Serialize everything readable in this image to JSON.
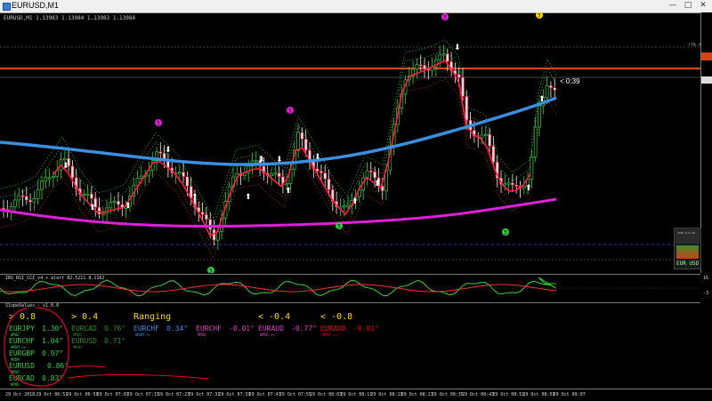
{
  "window": {
    "title": "EURUSD,M1",
    "controls": [
      "—",
      "□",
      "✕"
    ]
  },
  "chart_header": {
    "symbol_line": "EURUSD,M1 1.13983 1.13984 1.13983 1.13984"
  },
  "main_chart": {
    "countdown": "< 0:39",
    "level_label": "(76.4%)",
    "marker_digit": "3",
    "bar_countdown_prefix": "<",
    "widget_label": "EUR USD"
  },
  "indicator1": {
    "header": "IBS_RSI_CCI_v4 + alert 82.5211 8.1162",
    "scale_top": "16",
    "scale_bottom": "-3"
  },
  "indicator2": {
    "header": "SlopeValues - v1.0.6",
    "columns": [
      {
        "label": "> 0.8",
        "color": "#ffd700"
      },
      {
        "label": "> 0.4",
        "color": "#ffd700"
      },
      {
        "label": "Ranging",
        "color": "#ffd700"
      },
      {
        "label": "< -0.4",
        "color": "#ffd700"
      },
      {
        "label": "< -0.8",
        "color": "#ffd700"
      }
    ],
    "col1": [
      {
        "pair": "EURJPY",
        "value": "1.30°",
        "sub": "WMOD"
      },
      {
        "pair": "EURCHF",
        "value": "1.04°",
        "sub": "WMDM ++"
      },
      {
        "pair": "EURGBP",
        "value": "0.97°",
        "sub": "MDDM"
      },
      {
        "pair": "EURUSD",
        "value": "0.86°",
        "sub": "MMOD"
      },
      {
        "pair": "EURCAD",
        "value": "0.83°",
        "sub": "WDMD"
      }
    ],
    "col2": [
      {
        "pair": "EURCAD",
        "value": "0.76°",
        "sub": "MMOD"
      },
      {
        "pair": "EURUSD",
        "value": "0.71°",
        "sub": "MMOD"
      }
    ],
    "col3": [
      {
        "pair": "EURCHF",
        "value": "0.34°",
        "sub": "WDOM ++"
      }
    ],
    "col4": [
      {
        "pair": "EURCHF",
        "value": "-0.01°",
        "sub": "MMOD"
      },
      {
        "pair": "EURAUD",
        "value": "-0.77°",
        "sub": "WMOD ++"
      }
    ],
    "col5": [
      {
        "pair": "EURAUD",
        "value": "-0.91°",
        "sub": "WMOD ++"
      }
    ]
  },
  "time_axis": [
    "29 Oct 2018",
    "29 Oct 06:51",
    "29 Oct 06:59",
    "29 Oct 07:07",
    "29 Oct 07:15",
    "29 Oct 07:23",
    "29 Oct 07:31",
    "29 Oct 07:39",
    "29 Oct 07:47",
    "29 Oct 07:55",
    "29 Oct 08:03",
    "29 Oct 08:11",
    "29 Oct 08:19",
    "29 Oct 08:27",
    "29 Oct 08:35",
    "29 Oct 08:43",
    "29 Oct 08:51",
    "29 Oct 08:59",
    "29 Oct 09:07"
  ],
  "colors": {
    "background": "#000000",
    "ma_blue": "#3b8fe0",
    "ma_magenta": "#e21fd8",
    "resistance": "#d84315",
    "bull": "#2ecc40",
    "bear": "#e8002a",
    "column_header": "#ffd700"
  }
}
